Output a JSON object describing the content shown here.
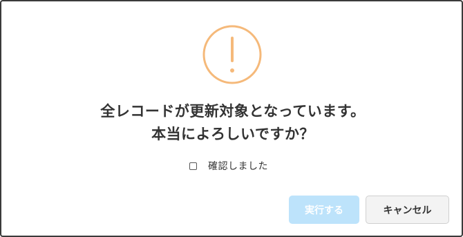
{
  "dialog": {
    "icon": "exclamation-circle-icon",
    "icon_color": "#f5b97a",
    "message_line1": "全レコードが更新対象となっています。",
    "message_line2": "本当によろしいですか？",
    "confirm_checkbox": {
      "label": "確認しました",
      "checked": false
    },
    "buttons": {
      "execute_label": "実行する",
      "execute_enabled": false,
      "execute_color": "#bde3fb",
      "cancel_label": "キャンセル"
    }
  }
}
